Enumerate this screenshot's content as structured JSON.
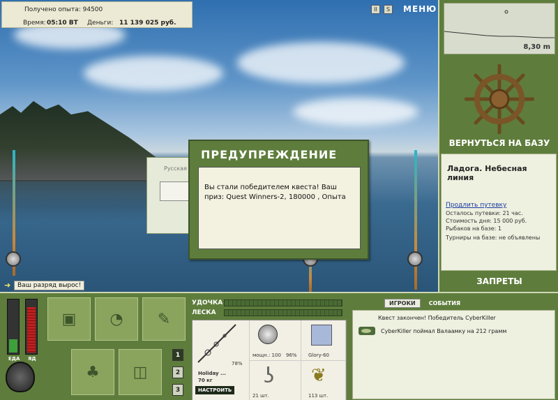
{
  "info": {
    "exp_label": "Получено опыта:",
    "exp_value": "94500",
    "time_label": "Время:",
    "time_value": "05:10 ВТ",
    "money_label": "Деньги:",
    "money_value": "11 139 025 руб."
  },
  "topbar": {
    "pause_glyph": "II",
    "sound_glyph": "S",
    "menu_label": "МЕНЮ"
  },
  "right_panel": {
    "depth_value": "8,30 m",
    "return_label": "ВЕРНУТЬСЯ НА БАЗУ",
    "location_title": "Ладога. Небесная линия",
    "extend_link": "Продлить путевку",
    "stats": [
      "Осталось путевки: 21 час.",
      "Стоимость дня: 15 000 руб.",
      "Рыбаков на базе: 1",
      "Турниры на базе: не объявлены"
    ],
    "bans_label": "ЗАПРЕТЫ"
  },
  "rank_notice": "Ваш разряд вырос!",
  "background_panel_title": "Русская",
  "dialog": {
    "title": "ПРЕДУПРЕЖДЕНИЕ",
    "message": "Вы стали победителем квеста! Ваш приз: Quest Winners-2, 180000 , Опыта"
  },
  "meters": {
    "food_label": "ЕДА",
    "poison_label": "ЯД",
    "food_level": 0.25,
    "poison_level": 0.85
  },
  "inventory": {
    "pages": [
      "1",
      "2",
      "3"
    ],
    "active_page": "1"
  },
  "tackle": {
    "rod_label": "УДОЧКА",
    "line_label": "ЛЕСКА",
    "rod_name": "Holiday ...",
    "rod_weight": "70 кг",
    "rod_percent": "78%",
    "reel_power": "мощн.: 100",
    "reel_percent": "96%",
    "lure_name": "Glory-60",
    "hook_count": "21 шт.",
    "bait_count": "113 шт.",
    "configure_label": "НАСТРОИТЬ"
  },
  "events": {
    "tab_players": "ИГРОКИ",
    "tab_events": "СОБЫТИЯ",
    "items": [
      "Квест закончен! Победитель CyberKiller",
      "CyberKiller поймал Валаамку на 212 грамм"
    ]
  }
}
